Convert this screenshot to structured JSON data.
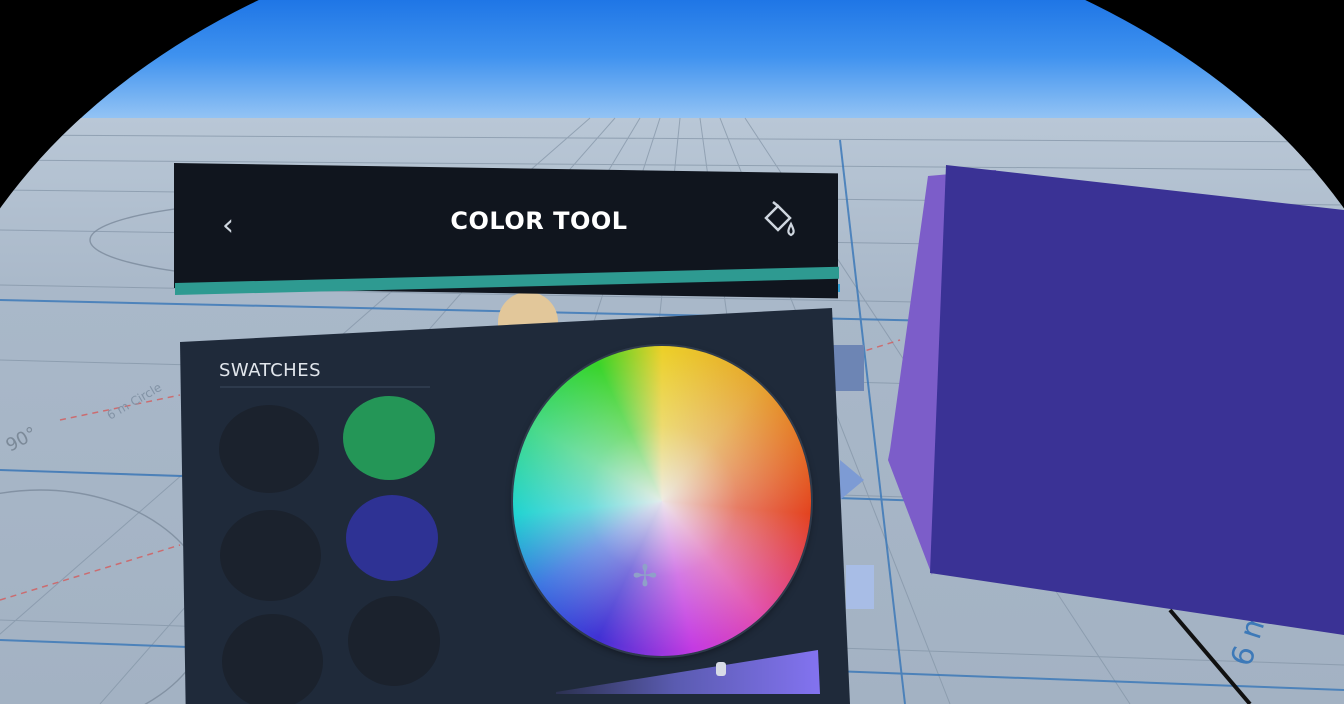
{
  "header": {
    "title": "COLOR TOOL",
    "back_icon": "chevron-left-icon",
    "fill_icon": "paint-bucket-icon"
  },
  "swatches": {
    "title": "SWATCHES",
    "items": [
      {
        "color": "#1b222d",
        "filled": false
      },
      {
        "color": "#249657",
        "filled": true
      },
      {
        "color": "#1b222d",
        "filled": false
      },
      {
        "color": "#2e3294",
        "filled": true
      },
      {
        "color": "#1b222d",
        "filled": false
      },
      {
        "color": "#1b222d",
        "filled": false
      }
    ]
  },
  "color_wheel": {
    "cursor_icon": "color-picker-cursor-icon"
  },
  "scene": {
    "floor_labels": [
      "6 m Circle",
      "90°",
      "6 m"
    ],
    "cube_color": "#3a3295",
    "cube_side_color": "#7c5dc9"
  },
  "colors": {
    "panel_bg": "#1f2a3a",
    "header_bg": "#10151e",
    "accent": "#2e9a91"
  }
}
